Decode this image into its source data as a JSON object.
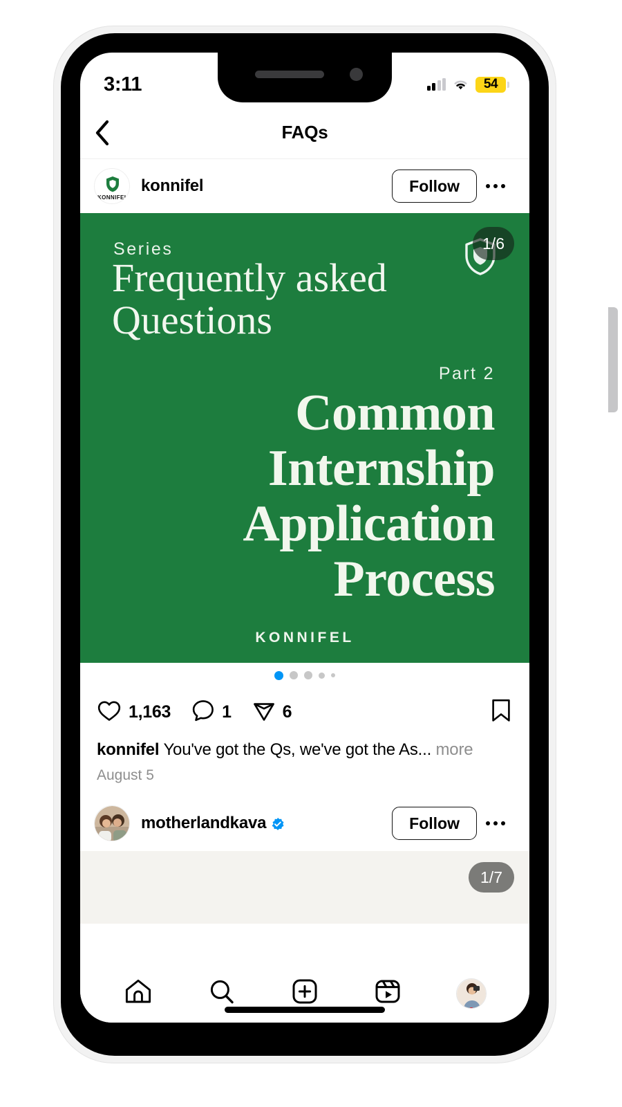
{
  "status_bar": {
    "time": "3:11",
    "battery_level": "54",
    "battery_color": "#fcd518",
    "signal_bars_active": 2,
    "signal_bars_total": 4
  },
  "nav": {
    "title": "FAQs",
    "back_icon": "chevron-left-icon"
  },
  "post1": {
    "username": "konnifel",
    "follow_label": "Follow",
    "avatar_brand": "KONNIFEL",
    "card": {
      "background_color": "#1d7d3e",
      "text_color": "#f2f7ed",
      "eyebrow": "Series",
      "heading": "Frequently asked Questions",
      "part": "Part 2",
      "title": "Common Internship Application Process",
      "brand": "KONNIFEL",
      "counter": "1/6"
    },
    "carousel_dots": {
      "total": 5,
      "active_index": 0,
      "active_color": "#0095f6",
      "inactive_color": "#c7c7c7"
    },
    "likes": "1,163",
    "comments": "1",
    "shares": "6",
    "caption_user": "konnifel",
    "caption_text": "You've got the Qs, we've got the As...",
    "caption_more": "more",
    "date": "August 5"
  },
  "post2": {
    "username": "motherlandkava",
    "verified": true,
    "follow_label": "Follow",
    "counter": "1/7"
  },
  "tabbar": {
    "items": [
      {
        "name": "home",
        "icon": "home-icon"
      },
      {
        "name": "search",
        "icon": "search-icon"
      },
      {
        "name": "create",
        "icon": "plus-square-icon"
      },
      {
        "name": "reels",
        "icon": "reels-icon"
      },
      {
        "name": "profile",
        "icon": "profile-avatar"
      }
    ],
    "profile_has_notification": true
  }
}
